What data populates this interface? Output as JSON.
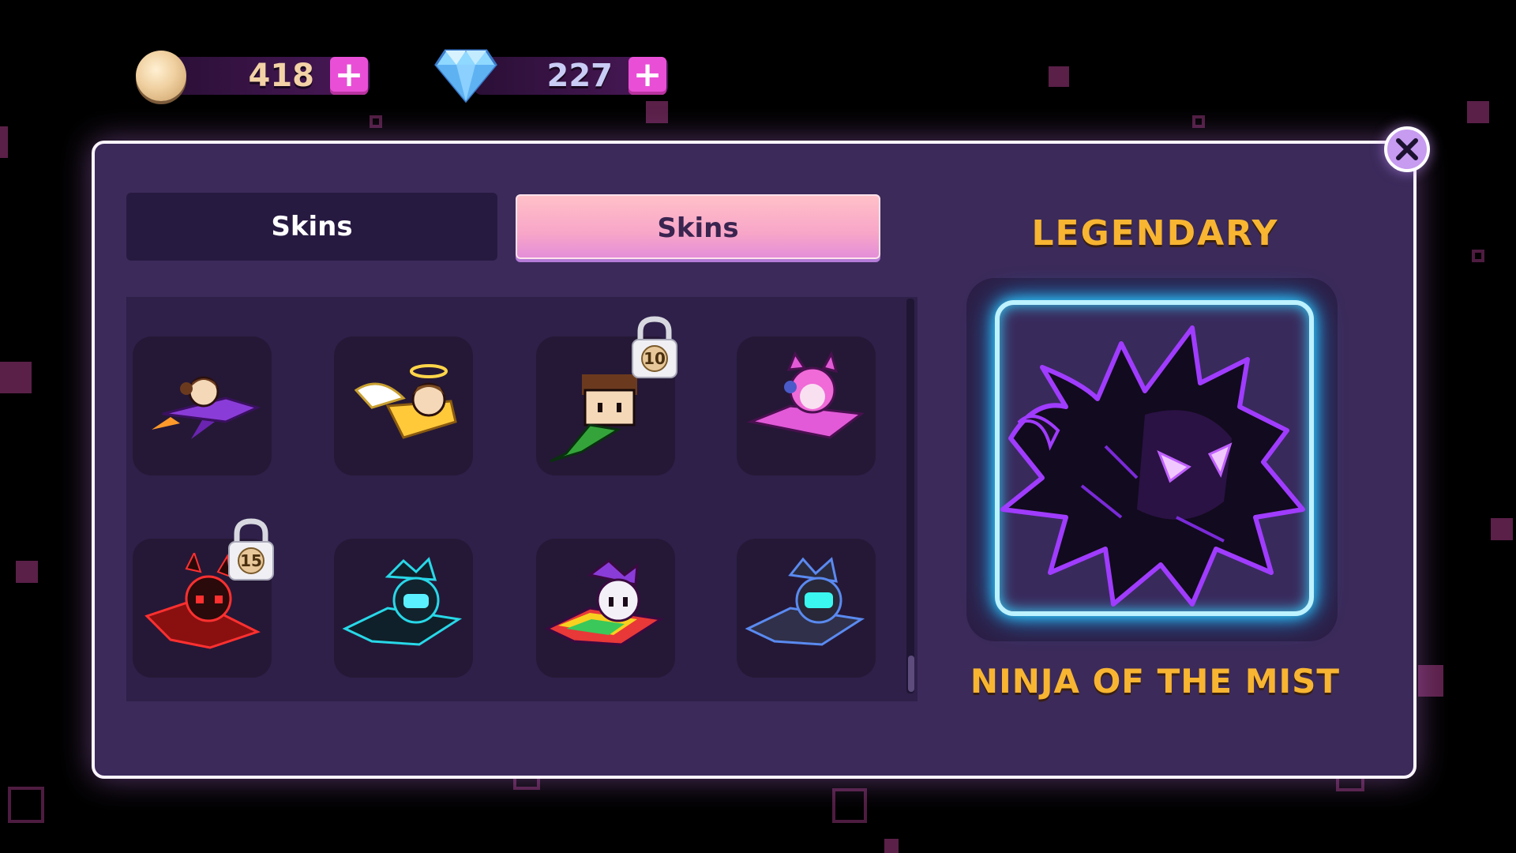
{
  "currencies": {
    "coins": {
      "value": "418",
      "add_label": "+",
      "icon": "coin-icon"
    },
    "gems": {
      "value": "227",
      "add_label": "+",
      "icon": "diamond-icon"
    }
  },
  "tabs": [
    {
      "label": "Skins",
      "active": false
    },
    {
      "label": "Skins",
      "active": true
    }
  ],
  "skins": [
    {
      "name": "rocket-girl",
      "locked": false
    },
    {
      "name": "angel-rider",
      "locked": false
    },
    {
      "name": "pixel-flyer",
      "locked": true,
      "unlock_level": "10"
    },
    {
      "name": "cat-pilot",
      "locked": false
    },
    {
      "name": "devil-jet",
      "locked": true,
      "unlock_level": "15"
    },
    {
      "name": "shadow-cyan",
      "locked": false
    },
    {
      "name": "rainbow-jet",
      "locked": false
    },
    {
      "name": "mech-pilot",
      "locked": false
    }
  ],
  "featured": {
    "rarity": "LEGENDARY",
    "name": "NINJA OF THE MIST"
  },
  "colors": {
    "panel": "#3b2a5a",
    "accent_gold": "#f8b531",
    "plus_button": "#e94fd6",
    "glow": "#35d5ff"
  }
}
